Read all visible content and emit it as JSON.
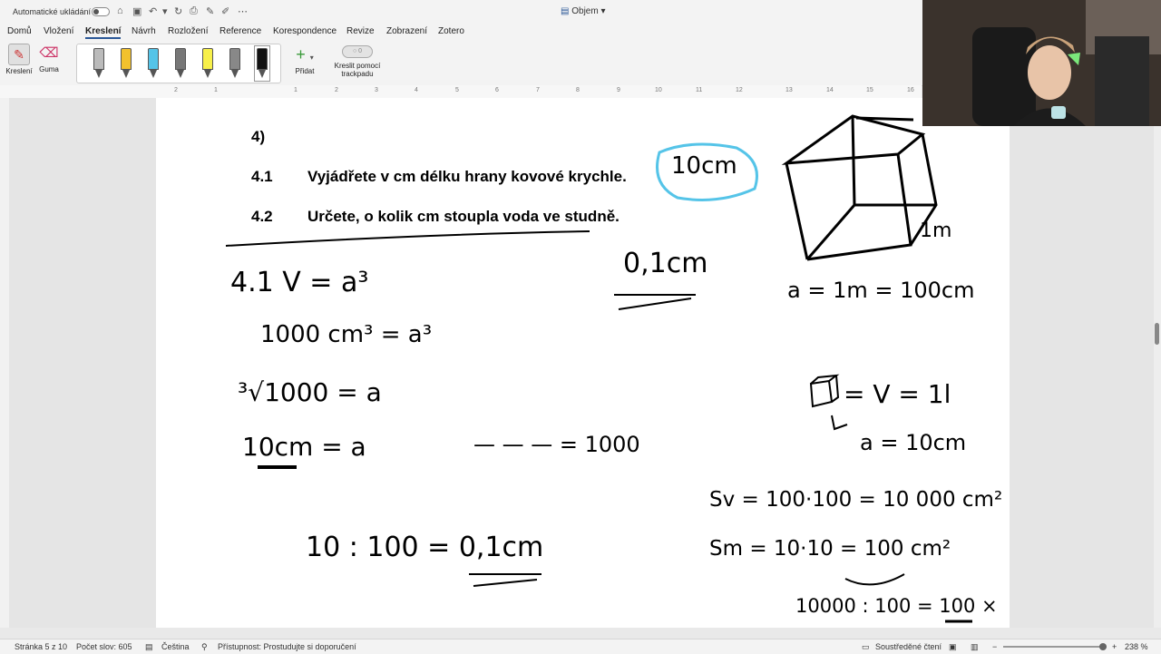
{
  "titlebar": {
    "autosave_label": "Automatické ukládání",
    "doc_title": "Objem"
  },
  "ribbon": {
    "tabs": [
      {
        "label": "Domů"
      },
      {
        "label": "Vložení"
      },
      {
        "label": "Kreslení"
      },
      {
        "label": "Návrh"
      },
      {
        "label": "Rozložení"
      },
      {
        "label": "Reference"
      },
      {
        "label": "Korespondence"
      },
      {
        "label": "Revize"
      },
      {
        "label": "Zobrazení"
      },
      {
        "label": "Zotero"
      }
    ],
    "active_tab": "Kreslení",
    "draw_label": "Kreslení",
    "eraser_label": "Guma",
    "add_label": "Přidat",
    "trackpad_label_1": "Kreslit pomocí",
    "trackpad_label_2": "trackpadu",
    "pen_colors": [
      "#bbbbbb",
      "#f2c12e",
      "#55c4e8",
      "#777777",
      "#f7f04a",
      "#888888",
      "#111111"
    ]
  },
  "ruler": {
    "marks": [
      "2",
      "1",
      "1",
      "2",
      "3",
      "4",
      "5",
      "6",
      "7",
      "8",
      "9",
      "10",
      "11",
      "12",
      "13",
      "14",
      "15",
      "16"
    ]
  },
  "document": {
    "q_num": "4)",
    "q1_num": "4.1",
    "q1_text": "Vyjádřete v cm délku hrany kovové krychle.",
    "q2_num": "4.2",
    "q2_text": "Určete, o kolik cm stoupla voda ve studně."
  },
  "handwriting": {
    "h1": "10cm",
    "h2": "0,1cm",
    "h3": "1m",
    "h4": "4.1  V = a³",
    "h5": "1000 cm³  =  a³",
    "h6": "³√1000  =  a",
    "h7": "10cm  =  a",
    "h8": "— — —  = 1000",
    "h9": "a = 1m = 100cm",
    "h10": "= V = 1l",
    "h11": "a = 10cm",
    "h12": "Sv = 100·100 = 10 000 cm²",
    "h13": "Sm = 10·10 = 100 cm²",
    "h14": "10 : 100 = 0,1cm",
    "h15": "10000 : 100 = 100 ×"
  },
  "statusbar": {
    "page": "Stránka 5 z 10",
    "words": "Počet slov: 605",
    "language": "Čeština",
    "accessibility": "Přístupnost: Prostudujte si doporučení",
    "focus": "Soustředěné čtení",
    "zoom": "238 %"
  },
  "colors": {
    "accent": "#2b5797",
    "highlight": "#55c4e8"
  }
}
